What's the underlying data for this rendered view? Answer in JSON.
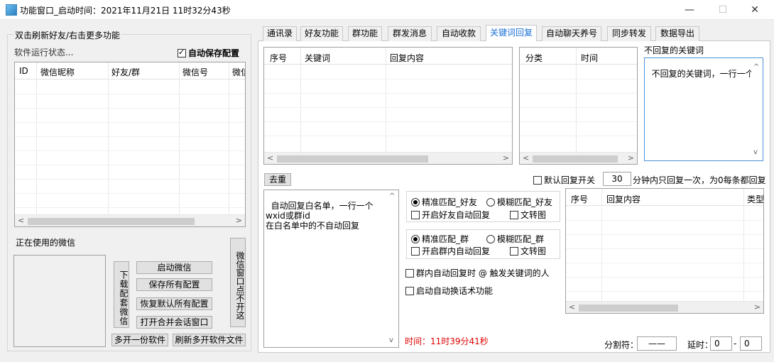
{
  "window": {
    "title": "功能窗口_启动时间：2021年11月21日 11时32分43秒",
    "minimize": "—",
    "maximize": "☐",
    "close": "✕"
  },
  "left": {
    "hint": "双击刷新好友/右击更多功能",
    "status": "软件运行状态...",
    "auto_save_label": "自动保存配置",
    "auto_save_checked": true,
    "table_headers": [
      "ID",
      "微信昵称",
      "好友/群",
      "微信号",
      "微信"
    ],
    "in_use_label": "正在使用的微信",
    "download_wechat": "下载配套微信",
    "start_wechat": "启动微信",
    "save_all": "保存所有配置",
    "restore_default": "恢复默认所有配置",
    "open_merge": "打开合并会话窗口",
    "wechat_window_no_close": "微信窗口点不开这",
    "multi_open": "多开一份软件",
    "refresh_multi": "刷新多开软件文件"
  },
  "tabs": [
    "通讯录",
    "好友功能",
    "群功能",
    "群发消息",
    "自动收款",
    "关键词回复",
    "自动聊天养号",
    "同步转发",
    "数据导出"
  ],
  "active_tab": "关键词回复",
  "keyword": {
    "table1_headers": [
      "序号",
      "关键词",
      "回复内容"
    ],
    "table2_headers": [
      "分类",
      "时间"
    ],
    "no_reply_label": "不回复的关键词",
    "no_reply_text": "不回复的关键词，一行一个",
    "dedupe": "去重",
    "default_reply_label": "默认回复开关",
    "minutes_value": "30",
    "minutes_suffix": "分钟内只回复一次，为0每条都回复",
    "whitelist_text": "自动回复白名单，一行一个\nwxid或群id\n在白名单中的不自动回复",
    "friend_exact": "精准匹配_好友",
    "friend_fuzzy": "模糊匹配_好友",
    "friend_auto": "开启好友自动回复",
    "friend_img": "文转图",
    "group_exact": "精准匹配_群",
    "group_fuzzy": "模糊匹配_群",
    "group_auto": "开启群内自动回复",
    "group_img": "文转图",
    "at_reply": "群内自动回复时 @ 触发关键词的人",
    "auto_switch": "启动自动换话术功能",
    "table3_headers": [
      "序号",
      "回复内容",
      "类型"
    ],
    "time_label": "时间：11时39分41秒",
    "separator_label": "分割符：",
    "separator_value": "——",
    "delay_label": "延时：",
    "delay_min": "0",
    "delay_dash": "-",
    "delay_max": "0"
  },
  "colors": {
    "accent": "#1a6fd6",
    "time_red": "#e00000"
  }
}
